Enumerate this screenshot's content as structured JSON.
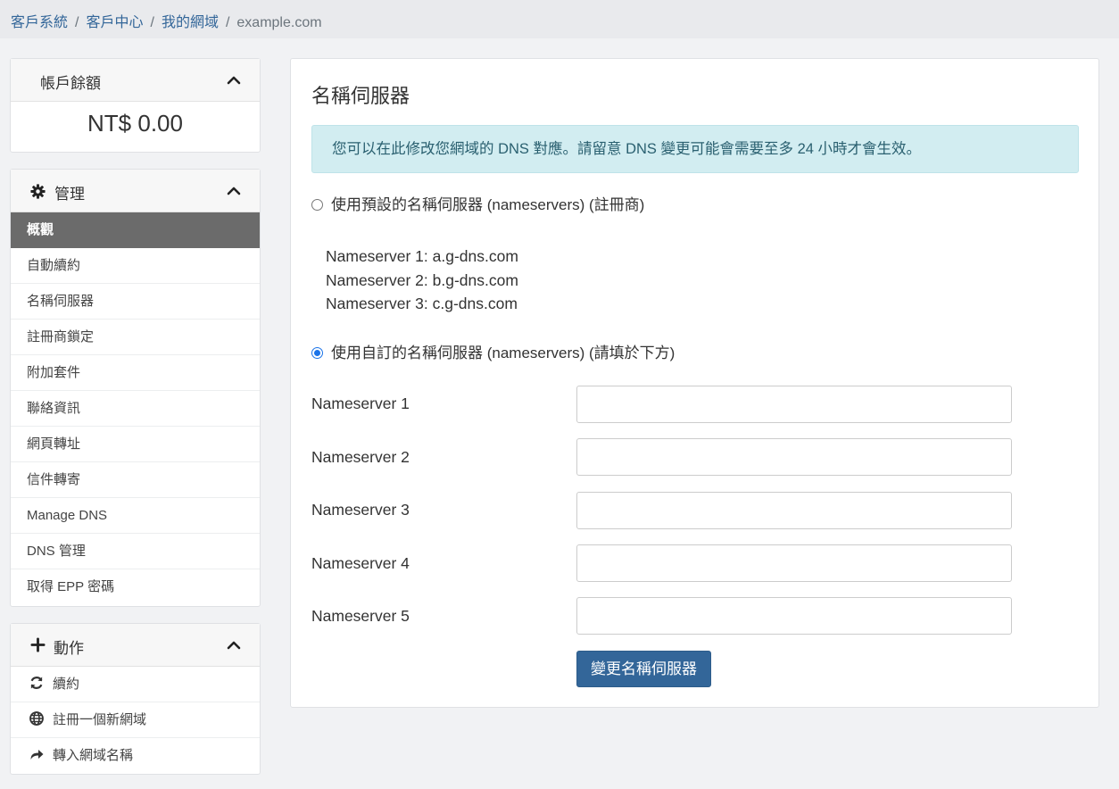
{
  "breadcrumb": {
    "items": [
      "客戶系統",
      "客戶中心",
      "我的網域"
    ],
    "current": "example.com",
    "separator": "/"
  },
  "balance_panel": {
    "title": "帳戶餘額",
    "value": "NT$ 0.00"
  },
  "manage_panel": {
    "title": "管理",
    "items": [
      {
        "label": "概觀",
        "active": true
      },
      {
        "label": "自動續約"
      },
      {
        "label": "名稱伺服器"
      },
      {
        "label": "註冊商鎖定"
      },
      {
        "label": "附加套件"
      },
      {
        "label": "聯絡資訊"
      },
      {
        "label": "網頁轉址"
      },
      {
        "label": "信件轉寄"
      },
      {
        "label": "Manage DNS"
      },
      {
        "label": "DNS 管理"
      },
      {
        "label": "取得 EPP 密碼"
      }
    ]
  },
  "actions_panel": {
    "title": "動作",
    "items": [
      {
        "label": "續約",
        "icon": "refresh-icon"
      },
      {
        "label": "註冊一個新網域",
        "icon": "globe-icon"
      },
      {
        "label": "轉入網域名稱",
        "icon": "share-arrow-icon"
      }
    ]
  },
  "main": {
    "title": "名稱伺服器",
    "alert": "您可以在此修改您網域的 DNS 對應。請留意 DNS 變更可能會需要至多 24 小時才會生效。",
    "option_default": {
      "label": "使用預設的名稱伺服器 (nameservers) (註冊商)",
      "checked": false
    },
    "default_nameservers": [
      "Nameserver 1: a.g-dns.com",
      "Nameserver 2: b.g-dns.com",
      "Nameserver 3: c.g-dns.com"
    ],
    "option_custom": {
      "label": "使用自訂的名稱伺服器 (nameservers) (請填於下方)",
      "checked": true
    },
    "fields": [
      {
        "label": "Nameserver 1",
        "value": ""
      },
      {
        "label": "Nameserver 2",
        "value": ""
      },
      {
        "label": "Nameserver 3",
        "value": ""
      },
      {
        "label": "Nameserver 4",
        "value": ""
      },
      {
        "label": "Nameserver 5",
        "value": ""
      }
    ],
    "submit_label": "變更名稱伺服器"
  },
  "colors": {
    "primary": "#336699",
    "active_menu_bg": "#6b6b6b",
    "alert_bg": "#d2edf1",
    "page_bg": "#f1f2f4"
  }
}
